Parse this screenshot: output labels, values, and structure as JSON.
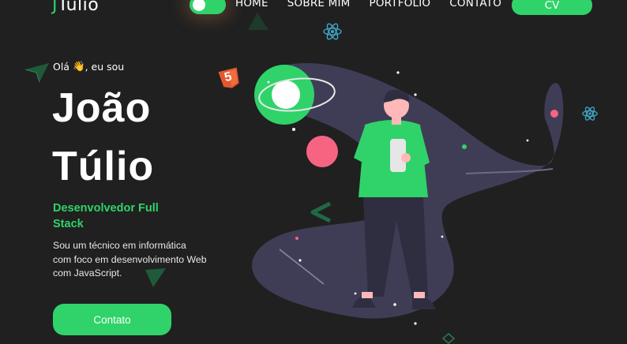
{
  "header": {
    "logo_first": "J",
    "logo_rest": "Túlio",
    "nav": [
      "HOME",
      "SOBRE MIM",
      "PORTFOLIO",
      "CONTATO"
    ],
    "cv_label": "CV",
    "theme_toggle_on": true
  },
  "hero": {
    "greeting_pre": "Olá",
    "greeting_emoji": "👋",
    "greeting_post": ", eu sou",
    "name_line1": "João",
    "name_line2": "Túlio",
    "role": "Desenvolvedor Full Stack",
    "bio": "Sou um técnico em informática com foco em desenvolvimento Web com JavaScript.",
    "contact_label": "Contato"
  },
  "decor": {
    "html5_badge": "5"
  },
  "colors": {
    "background": "#202020",
    "accent": "#2fd36a",
    "galaxy": "#3f3d56",
    "pink": "#f76482",
    "react_blue": "#3ea6c7",
    "html5_orange": "#e4572e"
  },
  "icons": [
    "theme-toggle",
    "waving-hand-icon",
    "react-icon",
    "html5-icon",
    "arrow-icon"
  ]
}
